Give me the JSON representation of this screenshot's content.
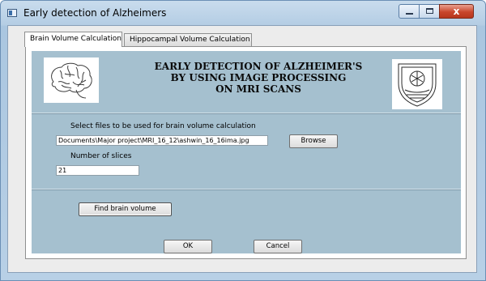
{
  "window": {
    "title": "Early detection of Alzheimers",
    "close_glyph": "x"
  },
  "tabs": [
    {
      "label": "Brain Volume Calculation",
      "active": true
    },
    {
      "label": "Hippocampal Volume Calculation",
      "active": false
    }
  ],
  "header": {
    "title": "EARLY DETECTION OF ALZHEIMER'S\nBY USING IMAGE PROCESSING\nON MRI SCANS",
    "left_image_icon": "brain-icon",
    "right_image_icon": "institute-emblem-icon"
  },
  "form": {
    "select_label": "Select files to be used for brain volume calculation",
    "file_path": "Documents\\Major project\\MRI_16_12\\ashwin_16_16ima.jpg",
    "browse_label": "Browse",
    "slices_label": "Number of slices",
    "slices_value": "21",
    "find_label": "Find brain volume"
  },
  "footer": {
    "ok_label": "OK",
    "cancel_label": "Cancel"
  },
  "colors": {
    "panel_bg": "#a5c0cf",
    "window_frame": "#b4cde4",
    "close_button": "#c9462c"
  }
}
